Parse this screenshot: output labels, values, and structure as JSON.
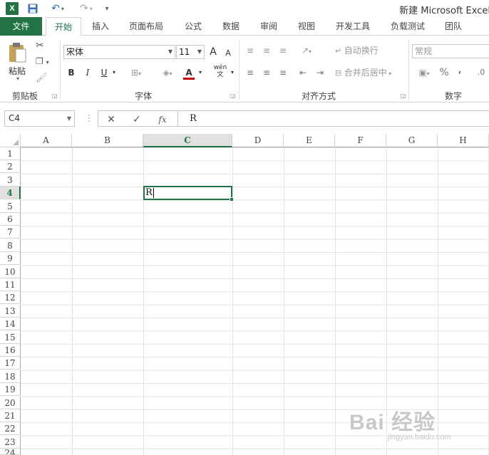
{
  "window": {
    "title": "新建 Microsoft Excel"
  },
  "quick_access": {
    "app_icon": "excel-logo-icon",
    "save_icon": "save-icon",
    "undo_icon": "undo-icon",
    "redo_icon": "redo-icon",
    "customize_icon": "customize-dropdown-icon"
  },
  "tabs": [
    {
      "label": "文件"
    },
    {
      "label": "开始"
    },
    {
      "label": "插入"
    },
    {
      "label": "页面布局"
    },
    {
      "label": "公式"
    },
    {
      "label": "数据"
    },
    {
      "label": "审阅"
    },
    {
      "label": "视图"
    },
    {
      "label": "开发工具"
    },
    {
      "label": "负载测试"
    },
    {
      "label": "团队"
    }
  ],
  "ribbon": {
    "clipboard": {
      "paste_label": "粘贴",
      "group_label": "剪贴板"
    },
    "font": {
      "font_name": "宋体",
      "font_size": "11",
      "bold": "B",
      "italic": "I",
      "underline": "U",
      "grow_font": "A",
      "shrink_font": "A",
      "font_color_glyph": "A",
      "phonetic": "wén",
      "group_label": "字体",
      "font_color": "#c00000"
    },
    "alignment": {
      "wrap_text": "自动换行",
      "merge_center": "合并后居中",
      "group_label": "对齐方式"
    },
    "number": {
      "format": "常规",
      "percent": "%",
      "comma": ",",
      "group_label": "数字"
    }
  },
  "formula_bar": {
    "name_box": "C4",
    "cancel_icon": "✕",
    "enter_icon": "✓",
    "fx_label": "fx",
    "content": "R"
  },
  "grid": {
    "columns": [
      "A",
      "B",
      "C",
      "D",
      "E",
      "F",
      "G",
      "H"
    ],
    "rows": [
      "1",
      "2",
      "3",
      "4",
      "5",
      "6",
      "7",
      "8",
      "9",
      "10",
      "11",
      "12",
      "13",
      "14",
      "15",
      "16",
      "17",
      "18",
      "19",
      "20",
      "21",
      "22",
      "23",
      "24"
    ],
    "active_column": "C",
    "active_row": "4",
    "active_cell_value": "R"
  },
  "watermark": {
    "main": "Bai 经验",
    "sub": "jingyan.baidu.com"
  },
  "colors": {
    "excel_green": "#217346",
    "font_color_red": "#c00000"
  }
}
